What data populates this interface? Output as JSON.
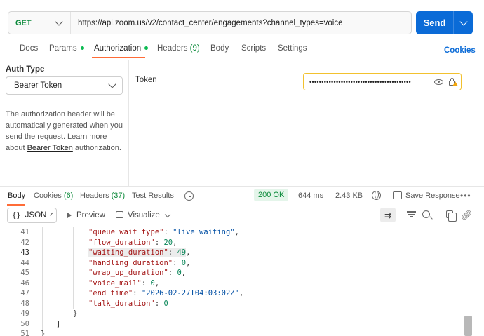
{
  "request": {
    "method": "GET",
    "url": "https://api.zoom.us/v2/contact_center/engagements?channel_types=voice",
    "send_label": "Send"
  },
  "request_tabs": {
    "docs": "Docs",
    "params": "Params",
    "authorization": "Authorization",
    "headers": "Headers",
    "headers_count": "(9)",
    "body": "Body",
    "scripts": "Scripts",
    "settings": "Settings",
    "cookies": "Cookies"
  },
  "auth": {
    "type_label": "Auth Type",
    "type_value": "Bearer Token",
    "description_pre": "The authorization header will be automatically generated when you send the request. Learn more about ",
    "description_link": "Bearer Token",
    "description_post": " authorization.",
    "token_label": "Token",
    "token_value": "••••••••••••••••••••••••••••••••••••••••••"
  },
  "response_tabs": {
    "body": "Body",
    "cookies": "Cookies",
    "cookies_count": "(6)",
    "headers": "Headers",
    "headers_count": "(37)",
    "test_results": "Test Results",
    "status": "200 OK",
    "time": "644 ms",
    "size": "2.43 KB",
    "save_response": "Save Response",
    "more": "•••"
  },
  "response_toolbar": {
    "format": "JSON",
    "preview": "Preview",
    "visualize": "Visualize"
  },
  "code": {
    "current_line": "43",
    "lines": [
      {
        "n": "41",
        "key": "\"queue_wait_type\"",
        "sep": ": ",
        "val": "\"live_waiting\"",
        "vtype": "str",
        "end": ","
      },
      {
        "n": "42",
        "key": "\"flow_duration\"",
        "sep": ": ",
        "val": "20",
        "vtype": "num",
        "end": ","
      },
      {
        "n": "43",
        "key": "\"waiting_duration\"",
        "sep": ": ",
        "val": "49",
        "vtype": "num",
        "end": ","
      },
      {
        "n": "44",
        "key": "\"handling_duration\"",
        "sep": ": ",
        "val": "0",
        "vtype": "num",
        "end": ","
      },
      {
        "n": "45",
        "key": "\"wrap_up_duration\"",
        "sep": ": ",
        "val": "0",
        "vtype": "num",
        "end": ","
      },
      {
        "n": "46",
        "key": "\"voice_mail\"",
        "sep": ": ",
        "val": "0",
        "vtype": "num",
        "end": ","
      },
      {
        "n": "47",
        "key": "\"end_time\"",
        "sep": ": ",
        "val": "\"2026-02-27T04:03:02Z\"",
        "vtype": "str",
        "end": ","
      },
      {
        "n": "48",
        "key": "\"talk_duration\"",
        "sep": ": ",
        "val": "0",
        "vtype": "num",
        "end": ""
      },
      {
        "n": "49",
        "key": "",
        "sep": "",
        "val": "}",
        "vtype": "punc",
        "end": ""
      },
      {
        "n": "50",
        "key": "",
        "sep": "",
        "val": "]",
        "vtype": "punc",
        "end": ""
      },
      {
        "n": "51",
        "key": "",
        "sep": "",
        "val": "}",
        "vtype": "punc",
        "end": ""
      }
    ]
  }
}
